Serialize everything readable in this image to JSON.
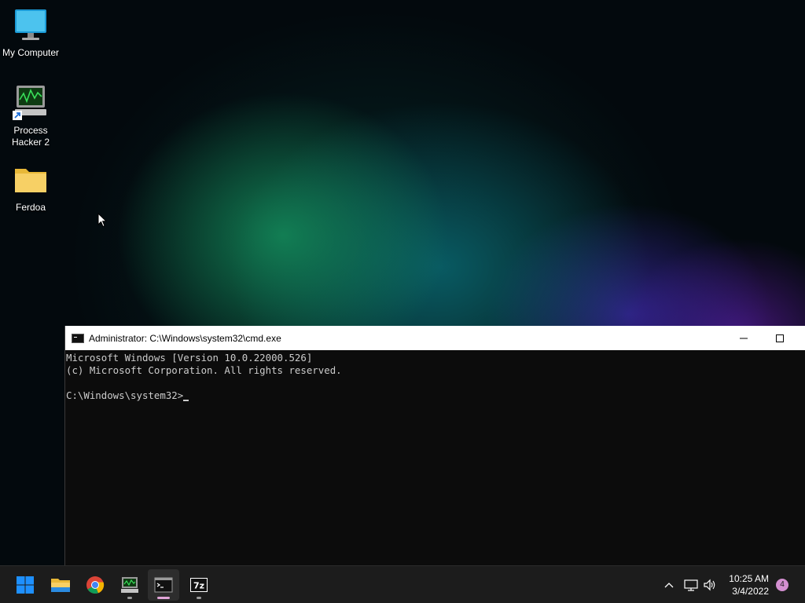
{
  "desktop": {
    "icons": [
      {
        "label": "My Computer"
      },
      {
        "label": "Process\nHacker 2"
      },
      {
        "label": "Ferdoa"
      }
    ]
  },
  "cmd_window": {
    "title": "Administrator: C:\\Windows\\system32\\cmd.exe",
    "lines": [
      "Microsoft Windows [Version 10.0.22000.526]",
      "(c) Microsoft Corporation. All rights reserved.",
      "",
      "C:\\Windows\\system32>"
    ]
  },
  "taskbar": {
    "apps": [
      "start",
      "file-explorer",
      "chrome",
      "process-hacker",
      "command-prompt",
      "7-zip"
    ],
    "clock": {
      "time": "10:25 AM",
      "date": "3/4/2022"
    },
    "notification_count": "4"
  },
  "colors": {
    "console_bg": "#0c0c0c",
    "console_text": "#cccccc",
    "taskbar_bg": "#1c1c1c",
    "start_blue": "#1e90ff",
    "active_indicator": "#e1a5d8"
  }
}
